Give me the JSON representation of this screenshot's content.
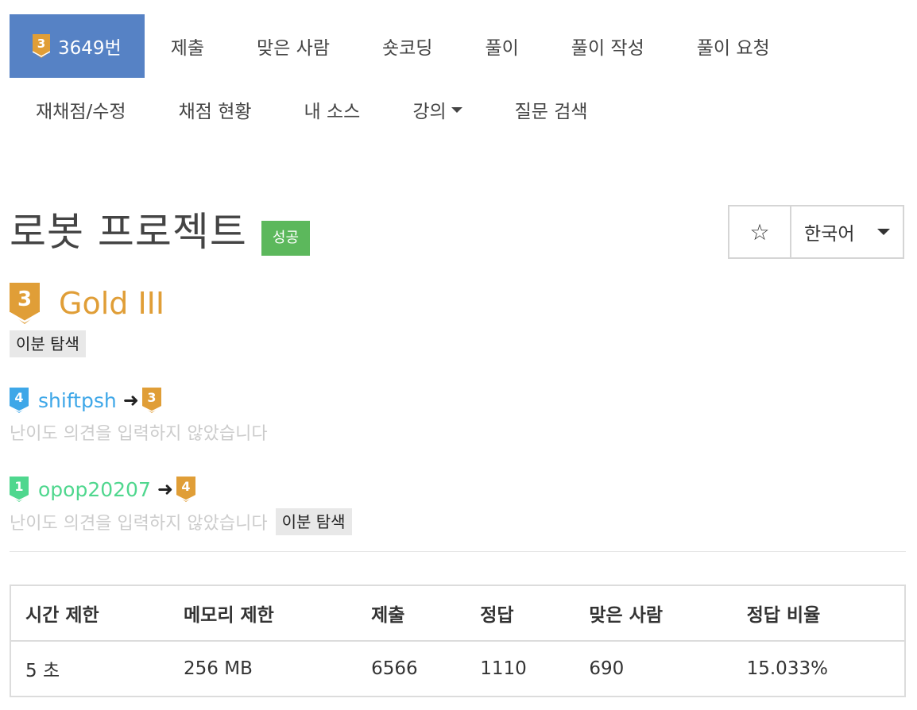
{
  "nav": {
    "row1": [
      {
        "label": "3649번",
        "active": true,
        "tier": "3"
      },
      {
        "label": "제출"
      },
      {
        "label": "맞은 사람"
      },
      {
        "label": "숏코딩"
      },
      {
        "label": "풀이"
      },
      {
        "label": "풀이 작성"
      },
      {
        "label": "풀이 요청"
      }
    ],
    "row2": [
      {
        "label": "재채점/수정"
      },
      {
        "label": "채점 현황"
      },
      {
        "label": "내 소스"
      },
      {
        "label": "강의"
      },
      {
        "label": "질문 검색"
      }
    ]
  },
  "problem": {
    "title": "로봇 프로젝트",
    "result_label": "성공",
    "tier_number": "3",
    "tier_name": "Gold III",
    "tag": "이분 탐색"
  },
  "toolbar": {
    "star_icon": "☆",
    "language": "한국어"
  },
  "opinions": [
    {
      "user": "shiftpsh",
      "user_tier": "4",
      "user_color": "#3ea7e8",
      "user_tier_color": "#3ea7e8",
      "arrow": "➜",
      "vote_tier": "3",
      "vote_color": "#e09e37",
      "text": "난이도 의견을 입력하지 않았습니다",
      "tag": ""
    },
    {
      "user": "opop20207",
      "user_tier": "1",
      "user_color": "#4fd78e",
      "user_tier_color": "#4fd78e",
      "arrow": "➜",
      "vote_tier": "4",
      "vote_color": "#e09e37",
      "text": "난이도 의견을 입력하지 않았습니다",
      "tag": "이분 탐색"
    }
  ],
  "info_table": {
    "headers": [
      "시간 제한",
      "메모리 제한",
      "제출",
      "정답",
      "맞은 사람",
      "정답 비율"
    ],
    "row": [
      "5 초",
      "256 MB",
      "6566",
      "1110",
      "690",
      "15.033%"
    ]
  },
  "colors": {
    "nav_active": "#5682c5",
    "gold": "#e09e37",
    "success": "#5cb85c"
  }
}
